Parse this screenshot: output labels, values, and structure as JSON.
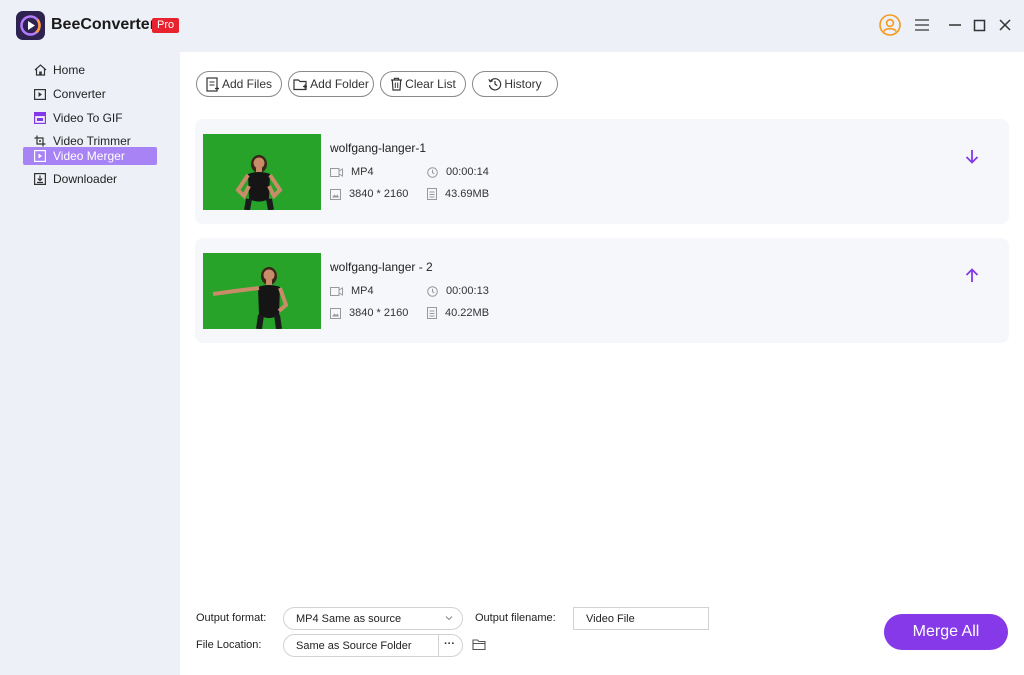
{
  "app": {
    "title": "BeeConverter",
    "badge": "Pro",
    "accent_color": "#8539e8",
    "badge_color": "#e8232f"
  },
  "titlebar_icons": [
    "user-icon",
    "menu-icon",
    "minimize-icon",
    "maximize-icon",
    "close-icon"
  ],
  "sidebar": {
    "items": [
      {
        "label": "Home",
        "icon": "home-icon"
      },
      {
        "label": "Converter",
        "icon": "converter-icon"
      },
      {
        "label": "Video To GIF",
        "icon": "gif-icon"
      },
      {
        "label": "Video Trimmer",
        "icon": "trim-icon"
      },
      {
        "label": "Video Merger",
        "icon": "merge-icon",
        "active": true
      },
      {
        "label": "Downloader",
        "icon": "download-icon"
      }
    ]
  },
  "toolbar": {
    "add_files": "Add Files",
    "add_folder": "Add Folder",
    "clear_list": "Clear List",
    "history": "History"
  },
  "files": [
    {
      "name": "wolfgang-langer-1",
      "format": "MP4",
      "duration": "00:00:14",
      "resolution": "3840 * 2160",
      "size": "43.69MB",
      "move_icon": "arrow-down-icon"
    },
    {
      "name": "wolfgang-langer - 2",
      "format": "MP4",
      "duration": "00:00:13",
      "resolution": "3840 * 2160",
      "size": "40.22MB",
      "move_icon": "arrow-up-icon"
    }
  ],
  "footer": {
    "output_format_label": "Output format:",
    "output_format_value": "MP4 Same as source",
    "output_filename_label": "Output filename:",
    "output_filename_value": "Video File",
    "file_location_label": "File Location:",
    "file_location_value": "Same as Source Folder",
    "browse_label": "···",
    "merge_all": "Merge All"
  }
}
